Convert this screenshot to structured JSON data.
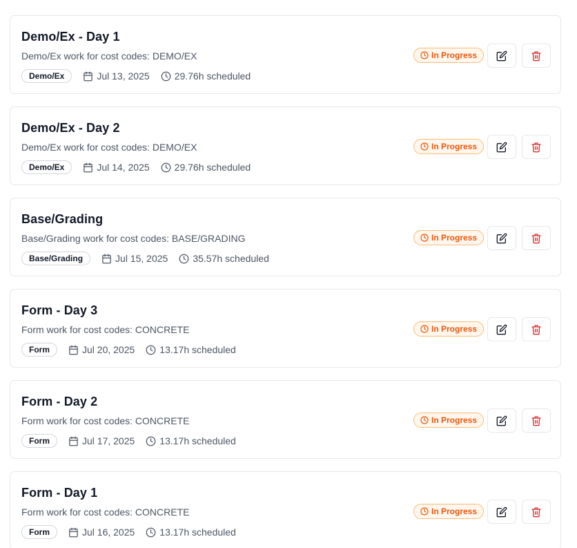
{
  "status_color": "#ea580c",
  "delete_color": "#dc2626",
  "items": [
    {
      "title": "Demo/Ex - Day 1",
      "description": "Demo/Ex work for cost codes: DEMO/EX",
      "tag": "Demo/Ex",
      "date": "Jul 13, 2025",
      "scheduled": "29.76h scheduled",
      "status": "In Progress"
    },
    {
      "title": "Demo/Ex - Day 2",
      "description": "Demo/Ex work for cost codes: DEMO/EX",
      "tag": "Demo/Ex",
      "date": "Jul 14, 2025",
      "scheduled": "29.76h scheduled",
      "status": "In Progress"
    },
    {
      "title": "Base/Grading",
      "description": "Base/Grading work for cost codes: BASE/GRADING",
      "tag": "Base/Grading",
      "date": "Jul 15, 2025",
      "scheduled": "35.57h scheduled",
      "status": "In Progress"
    },
    {
      "title": "Form - Day 3",
      "description": "Form work for cost codes: CONCRETE",
      "tag": "Form",
      "date": "Jul 20, 2025",
      "scheduled": "13.17h scheduled",
      "status": "In Progress"
    },
    {
      "title": "Form - Day 2",
      "description": "Form work for cost codes: CONCRETE",
      "tag": "Form",
      "date": "Jul 17, 2025",
      "scheduled": "13.17h scheduled",
      "status": "In Progress"
    },
    {
      "title": "Form - Day 1",
      "description": "Form work for cost codes: CONCRETE",
      "tag": "Form",
      "date": "Jul 16, 2025",
      "scheduled": "13.17h scheduled",
      "status": "In Progress"
    }
  ]
}
